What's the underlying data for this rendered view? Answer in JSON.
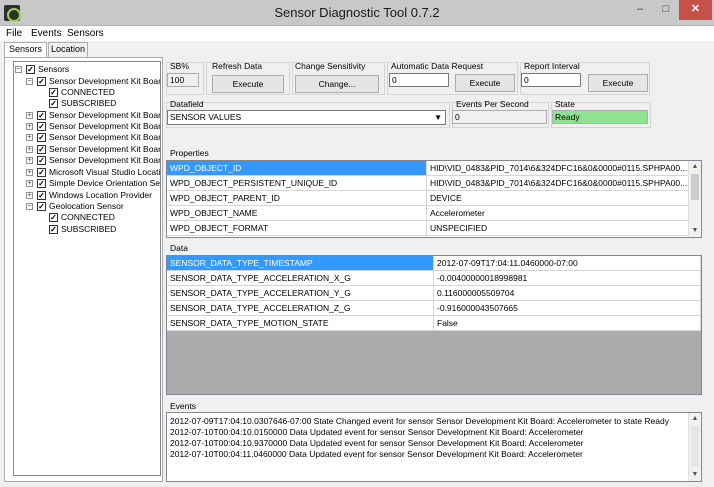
{
  "window": {
    "title": "Sensor Diagnostic Tool 0.7.2",
    "minimize": "–",
    "maximize": "□",
    "close": "✕"
  },
  "menu": {
    "file": "File",
    "events": "Events",
    "sensors": "Sensors"
  },
  "tabs": {
    "sensors": "Sensors",
    "location": "Location"
  },
  "tree": {
    "root": "Sensors",
    "items": [
      "Sensor Development Kit Board",
      "CONNECTED",
      "SUBSCRIBED",
      "Sensor Development Kit Board",
      "Sensor Development Kit Board",
      "Sensor Development Kit Board",
      "Sensor Development Kit Board",
      "Sensor Development Kit Board",
      "Microsoft Visual Studio Location",
      "Simple Device Orientation Sensor",
      "Windows Location Provider",
      "Geolocation Sensor",
      "CONNECTED",
      "SUBSCRIBED"
    ]
  },
  "controls": {
    "sb_label": "SB%",
    "sb_value": "100",
    "refresh_label": "Refresh Data",
    "refresh_button": "Execute",
    "sensitivity_label": "Change Sensitivity",
    "sensitivity_button": "Change...",
    "auto_label": "Automatic Data Request",
    "auto_value": "0",
    "auto_button": "Execute",
    "report_label": "Report Interval",
    "report_value": "0",
    "report_button": "Execute",
    "datafield_label": "Datafield",
    "datafield_value": "SENSOR VALUES",
    "eps_label": "Events Per Second",
    "eps_value": "0",
    "state_label": "State",
    "state_value": "Ready"
  },
  "properties": {
    "label": "Properties",
    "rows": [
      [
        "WPD_OBJECT_ID",
        "HID\\VID_0483&PID_7014\\6&324DFC16&0&0000#0115.SPHPA00..."
      ],
      [
        "WPD_OBJECT_PERSISTENT_UNIQUE_ID",
        "HID\\VID_0483&PID_7014\\6&324DFC16&0&0000#0115.SPHPA00..."
      ],
      [
        "WPD_OBJECT_PARENT_ID",
        "DEVICE"
      ],
      [
        "WPD_OBJECT_NAME",
        "Accelerometer"
      ],
      [
        "WPD_OBJECT_FORMAT",
        "UNSPECIFIED"
      ]
    ]
  },
  "data": {
    "label": "Data",
    "rows": [
      [
        "SENSOR_DATA_TYPE_TIMESTAMP",
        "2012-07-09T17:04:11.0460000-07:00"
      ],
      [
        "SENSOR_DATA_TYPE_ACCELERATION_X_G",
        "-0.00400000018998981"
      ],
      [
        "SENSOR_DATA_TYPE_ACCELERATION_Y_G",
        "0.116000005509704"
      ],
      [
        "SENSOR_DATA_TYPE_ACCELERATION_Z_G",
        "-0.916000043507665"
      ],
      [
        "SENSOR_DATA_TYPE_MOTION_STATE",
        "False"
      ]
    ]
  },
  "events": {
    "label": "Events",
    "lines": [
      "2012-07-09T17:04:10.0307646-07:00 State Changed event for sensor Sensor Development Kit Board: Accelerometer to state Ready",
      "2012-07-10T00:04:10.0150000 Data Updated event for sensor Sensor Development Kit Board: Accelerometer",
      "2012-07-10T00:04:10.9370000 Data Updated event for sensor Sensor Development Kit Board: Accelerometer",
      "2012-07-10T00:04:11.0460000 Data Updated event for sensor Sensor Development Kit Board: Accelerometer"
    ]
  },
  "colors": {
    "selection": "#3399ff",
    "state_ready": "#8fe28f",
    "close_button": "#c7504b"
  }
}
